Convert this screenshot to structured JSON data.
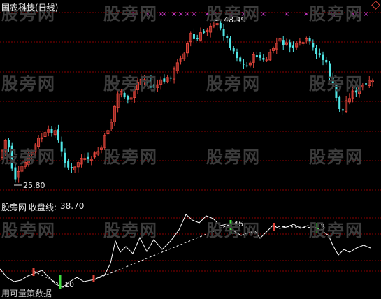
{
  "window": {
    "title": "国农科技(日线)"
  },
  "watermark": {
    "text": "股旁网"
  },
  "price_panel": {
    "high_label": "48.49",
    "low_label": "25.80",
    "high": 48.49,
    "low": 25.8,
    "colors": {
      "up": "#e0443a",
      "down": "#50e6e6",
      "grid": "#8b0000",
      "signal": "#e040e0",
      "label": "#e6e6e6"
    }
  },
  "indicator": {
    "name": "股旁网",
    "line_label": "收盘线:",
    "line_value": "38.70",
    "labels": {
      "pivot_low": "10",
      "pivot_high": "46",
      "right": "3"
    },
    "colors": {
      "line": "#ffffff",
      "buy": "#e0443a",
      "sell": "#40e040",
      "trend": "#ffffff"
    }
  },
  "footer": {
    "note": "用可量策数据"
  },
  "chart_data": {
    "type": "candlestick",
    "title": "国农科技(日线)",
    "series_length": 113,
    "price_range": [
      25.8,
      48.49
    ],
    "marked_extremes": {
      "high": 48.49,
      "low": 25.8
    },
    "signal_marker": "×",
    "signal_candles": [
      40,
      44,
      48,
      49,
      52,
      54,
      56,
      58,
      62,
      64,
      69,
      73,
      79,
      86,
      92,
      100,
      106,
      108,
      110
    ],
    "indicator": {
      "name": "股旁网",
      "line_name": "收盘线",
      "last_value": 38.7,
      "labels": [
        "10",
        "46",
        "3"
      ]
    }
  }
}
